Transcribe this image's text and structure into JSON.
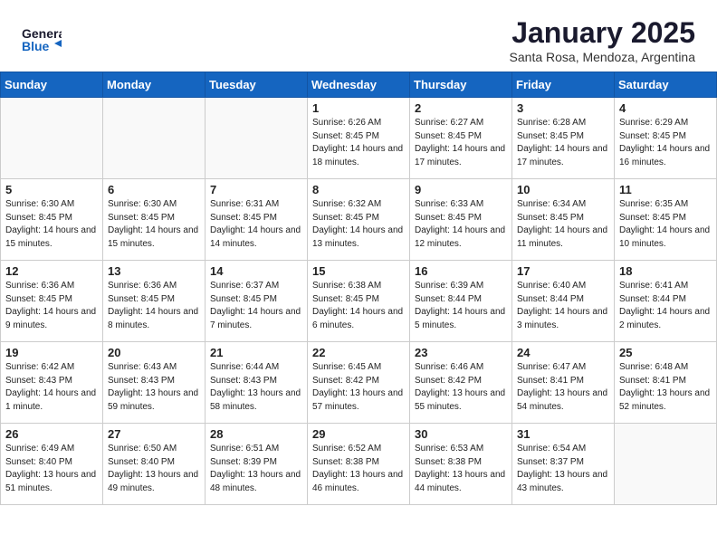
{
  "header": {
    "logo_general": "General",
    "logo_blue": "Blue",
    "month_title": "January 2025",
    "subtitle": "Santa Rosa, Mendoza, Argentina"
  },
  "weekdays": [
    "Sunday",
    "Monday",
    "Tuesday",
    "Wednesday",
    "Thursday",
    "Friday",
    "Saturday"
  ],
  "weeks": [
    [
      {
        "day": "",
        "info": ""
      },
      {
        "day": "",
        "info": ""
      },
      {
        "day": "",
        "info": ""
      },
      {
        "day": "1",
        "info": "Sunrise: 6:26 AM\nSunset: 8:45 PM\nDaylight: 14 hours\nand 18 minutes."
      },
      {
        "day": "2",
        "info": "Sunrise: 6:27 AM\nSunset: 8:45 PM\nDaylight: 14 hours\nand 17 minutes."
      },
      {
        "day": "3",
        "info": "Sunrise: 6:28 AM\nSunset: 8:45 PM\nDaylight: 14 hours\nand 17 minutes."
      },
      {
        "day": "4",
        "info": "Sunrise: 6:29 AM\nSunset: 8:45 PM\nDaylight: 14 hours\nand 16 minutes."
      }
    ],
    [
      {
        "day": "5",
        "info": "Sunrise: 6:30 AM\nSunset: 8:45 PM\nDaylight: 14 hours\nand 15 minutes."
      },
      {
        "day": "6",
        "info": "Sunrise: 6:30 AM\nSunset: 8:45 PM\nDaylight: 14 hours\nand 15 minutes."
      },
      {
        "day": "7",
        "info": "Sunrise: 6:31 AM\nSunset: 8:45 PM\nDaylight: 14 hours\nand 14 minutes."
      },
      {
        "day": "8",
        "info": "Sunrise: 6:32 AM\nSunset: 8:45 PM\nDaylight: 14 hours\nand 13 minutes."
      },
      {
        "day": "9",
        "info": "Sunrise: 6:33 AM\nSunset: 8:45 PM\nDaylight: 14 hours\nand 12 minutes."
      },
      {
        "day": "10",
        "info": "Sunrise: 6:34 AM\nSunset: 8:45 PM\nDaylight: 14 hours\nand 11 minutes."
      },
      {
        "day": "11",
        "info": "Sunrise: 6:35 AM\nSunset: 8:45 PM\nDaylight: 14 hours\nand 10 minutes."
      }
    ],
    [
      {
        "day": "12",
        "info": "Sunrise: 6:36 AM\nSunset: 8:45 PM\nDaylight: 14 hours\nand 9 minutes."
      },
      {
        "day": "13",
        "info": "Sunrise: 6:36 AM\nSunset: 8:45 PM\nDaylight: 14 hours\nand 8 minutes."
      },
      {
        "day": "14",
        "info": "Sunrise: 6:37 AM\nSunset: 8:45 PM\nDaylight: 14 hours\nand 7 minutes."
      },
      {
        "day": "15",
        "info": "Sunrise: 6:38 AM\nSunset: 8:45 PM\nDaylight: 14 hours\nand 6 minutes."
      },
      {
        "day": "16",
        "info": "Sunrise: 6:39 AM\nSunset: 8:44 PM\nDaylight: 14 hours\nand 5 minutes."
      },
      {
        "day": "17",
        "info": "Sunrise: 6:40 AM\nSunset: 8:44 PM\nDaylight: 14 hours\nand 3 minutes."
      },
      {
        "day": "18",
        "info": "Sunrise: 6:41 AM\nSunset: 8:44 PM\nDaylight: 14 hours\nand 2 minutes."
      }
    ],
    [
      {
        "day": "19",
        "info": "Sunrise: 6:42 AM\nSunset: 8:43 PM\nDaylight: 14 hours\nand 1 minute."
      },
      {
        "day": "20",
        "info": "Sunrise: 6:43 AM\nSunset: 8:43 PM\nDaylight: 13 hours\nand 59 minutes."
      },
      {
        "day": "21",
        "info": "Sunrise: 6:44 AM\nSunset: 8:43 PM\nDaylight: 13 hours\nand 58 minutes."
      },
      {
        "day": "22",
        "info": "Sunrise: 6:45 AM\nSunset: 8:42 PM\nDaylight: 13 hours\nand 57 minutes."
      },
      {
        "day": "23",
        "info": "Sunrise: 6:46 AM\nSunset: 8:42 PM\nDaylight: 13 hours\nand 55 minutes."
      },
      {
        "day": "24",
        "info": "Sunrise: 6:47 AM\nSunset: 8:41 PM\nDaylight: 13 hours\nand 54 minutes."
      },
      {
        "day": "25",
        "info": "Sunrise: 6:48 AM\nSunset: 8:41 PM\nDaylight: 13 hours\nand 52 minutes."
      }
    ],
    [
      {
        "day": "26",
        "info": "Sunrise: 6:49 AM\nSunset: 8:40 PM\nDaylight: 13 hours\nand 51 minutes."
      },
      {
        "day": "27",
        "info": "Sunrise: 6:50 AM\nSunset: 8:40 PM\nDaylight: 13 hours\nand 49 minutes."
      },
      {
        "day": "28",
        "info": "Sunrise: 6:51 AM\nSunset: 8:39 PM\nDaylight: 13 hours\nand 48 minutes."
      },
      {
        "day": "29",
        "info": "Sunrise: 6:52 AM\nSunset: 8:38 PM\nDaylight: 13 hours\nand 46 minutes."
      },
      {
        "day": "30",
        "info": "Sunrise: 6:53 AM\nSunset: 8:38 PM\nDaylight: 13 hours\nand 44 minutes."
      },
      {
        "day": "31",
        "info": "Sunrise: 6:54 AM\nSunset: 8:37 PM\nDaylight: 13 hours\nand 43 minutes."
      },
      {
        "day": "",
        "info": ""
      }
    ]
  ]
}
